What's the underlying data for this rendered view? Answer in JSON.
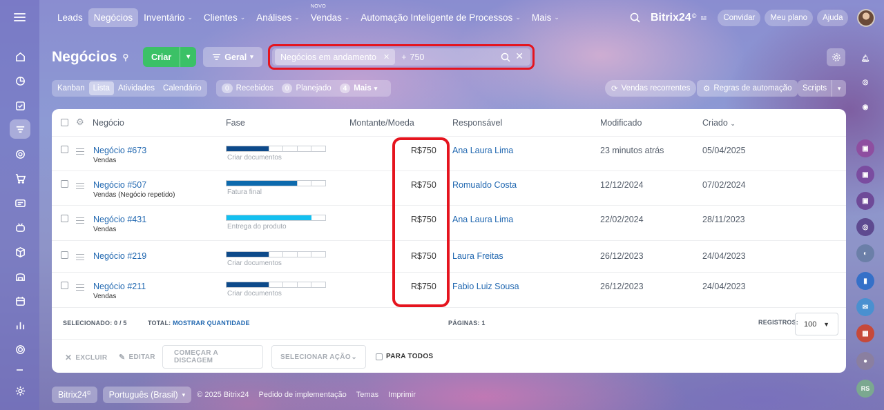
{
  "nav": {
    "items": [
      {
        "label": "Leads",
        "chevron": false
      },
      {
        "label": "Negócios",
        "chevron": false,
        "active": true
      },
      {
        "label": "Inventário",
        "chevron": true
      },
      {
        "label": "Clientes",
        "chevron": true
      },
      {
        "label": "Análises",
        "chevron": true
      },
      {
        "label": "Vendas",
        "chevron": true,
        "badge": "NOVO"
      },
      {
        "label": "Automação Inteligente de Processos",
        "chevron": true
      },
      {
        "label": "Mais",
        "chevron": true
      }
    ],
    "brand": "Bitrix24",
    "brand_mark": "©",
    "invite": "Convidar",
    "plan": "Meu plano",
    "help": "Ajuda"
  },
  "page": {
    "title": "Negócios",
    "create": "Criar",
    "general": "Geral",
    "filter_chip": "Negócios em andamento",
    "search_value": "750"
  },
  "views": {
    "tabs": [
      "Kanban",
      "Lista",
      "Atividades",
      "Calendário"
    ],
    "active": "Lista",
    "counters": [
      {
        "count": "0",
        "label": "Recebidos"
      },
      {
        "count": "0",
        "label": "Planejado"
      },
      {
        "count": "4",
        "label": "Mais"
      }
    ],
    "recurring": "Vendas recorrentes",
    "automation": "Regras de automação",
    "scripts": "Scripts"
  },
  "grid": {
    "columns": [
      "Negócio",
      "Fase",
      "Montante/Moeda",
      "Responsável",
      "Modificado",
      "Criado"
    ],
    "rows": [
      {
        "deal": "Negócio #673",
        "sub": "Vendas",
        "stage": "Criar documentos",
        "amount": "R$750",
        "owner": "Ana Laura Lima",
        "modified": "23 minutos atrás",
        "created": "05/04/2025"
      },
      {
        "deal": "Negócio #507",
        "sub": "Vendas (Negócio repetido)",
        "stage": "Fatura final",
        "amount": "R$750",
        "owner": "Romualdo Costa",
        "modified": "12/12/2024",
        "created": "07/02/2024"
      },
      {
        "deal": "Negócio #431",
        "sub": "Vendas",
        "stage": "Entrega do produto",
        "amount": "R$750",
        "owner": "Ana Laura Lima",
        "modified": "22/02/2024",
        "created": "28/11/2023"
      },
      {
        "deal": "Negócio #219",
        "sub": "",
        "stage": "Criar documentos",
        "amount": "R$750",
        "owner": "Laura Freitas",
        "modified": "26/12/2023",
        "created": "24/04/2023"
      },
      {
        "deal": "Negócio #211",
        "sub": "Vendas",
        "stage": "Criar documentos",
        "amount": "R$750",
        "owner": "Fabio Luiz Sousa",
        "modified": "26/12/2023",
        "created": "24/04/2023"
      }
    ],
    "stage_progress": [
      0.42,
      0.7,
      0.85,
      0.42,
      0.42
    ],
    "stage_colors": [
      "#0d4a8a",
      "#0d6aad",
      "#14c0f0",
      "#0d4a8a",
      "#0d4a8a"
    ],
    "selected_label": "SELECIONADO:",
    "selected_value": "0 / 5",
    "total_label": "TOTAL:",
    "total_link": "MOSTRAR QUANTIDADE",
    "pages_label": "PÁGINAS:",
    "pages_value": "1",
    "records_label": "REGISTROS:",
    "records_value": "100"
  },
  "actions": {
    "delete": "EXCLUIR",
    "edit": "EDITAR",
    "dial": "COMEÇAR A DISCAGEM",
    "select": "SELECIONAR AÇÃO",
    "for_all": "PARA TODOS"
  },
  "footer": {
    "brand": "Bitrix24",
    "language": "Português (Brasil)",
    "copyright": "© 2025 Bitrix24",
    "links": [
      "Pedido de implementação",
      "Temas",
      "Imprimir"
    ]
  },
  "user_initials": "RS"
}
